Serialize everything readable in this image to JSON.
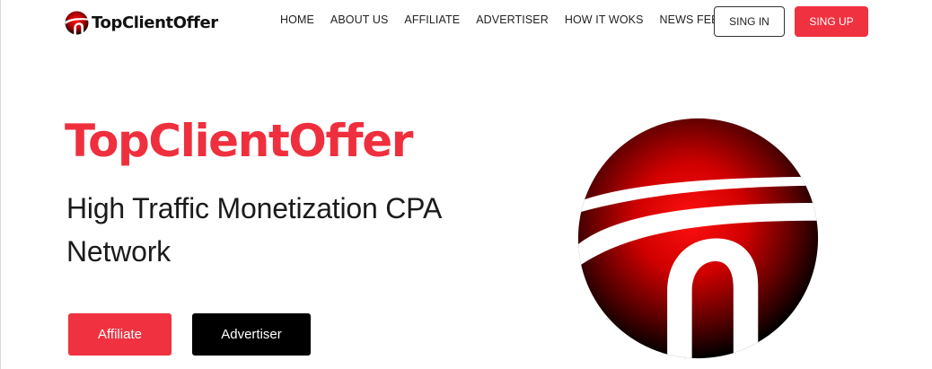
{
  "brand": {
    "name": "TopClientOffer",
    "logo_icon": "brand-logo-icon",
    "primary_color": "#f0313f",
    "dark_color": "#000000"
  },
  "nav": {
    "items": [
      {
        "label": "HOME"
      },
      {
        "label": "ABOUT US"
      },
      {
        "label": "AFFILIATE"
      },
      {
        "label": "ADVERTISER"
      },
      {
        "label": "HOW IT WOKS"
      },
      {
        "label": "NEWS FEED"
      }
    ],
    "signin_label": "SING IN",
    "signup_label": "SING UP"
  },
  "hero": {
    "title": "TopClientOffer",
    "subtitle": "High Traffic Monetization CPA Network",
    "affiliate_label": "Affiliate",
    "advertiser_label": "Advertiser",
    "emblem_icon": "brand-emblem-icon"
  }
}
